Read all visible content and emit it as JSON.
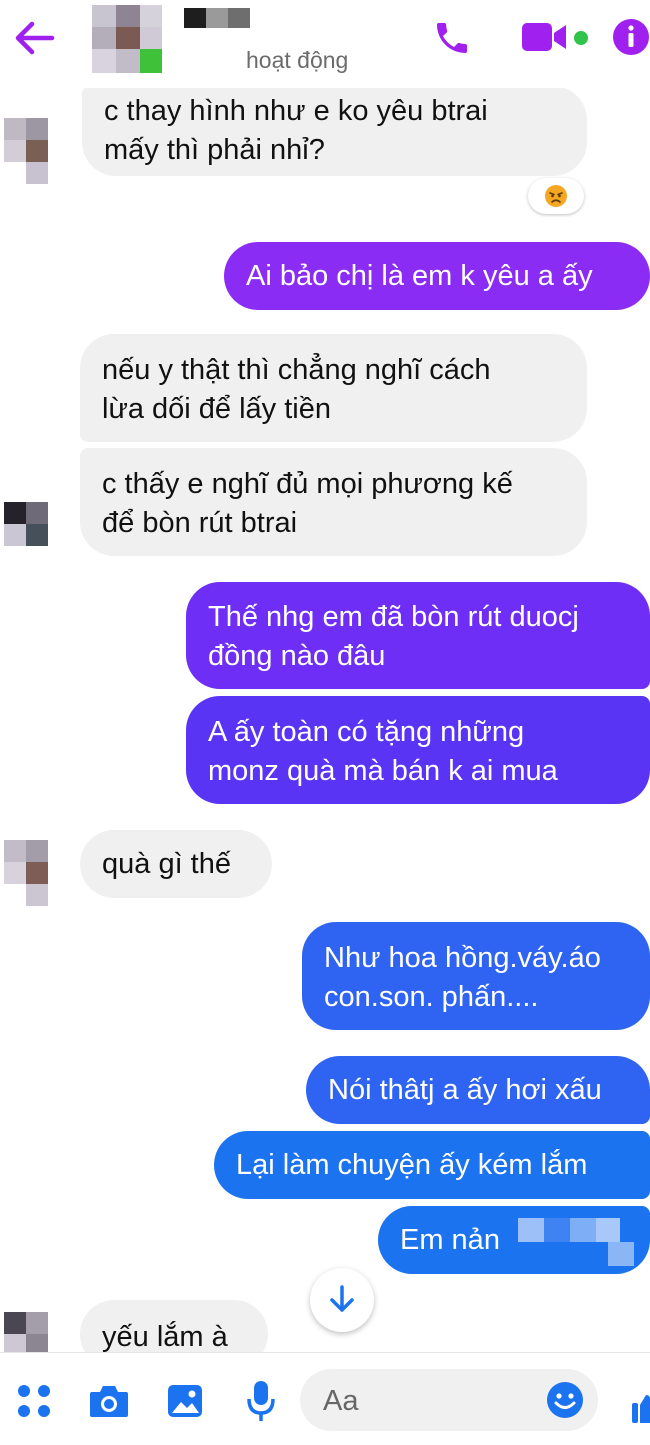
{
  "header": {
    "status_text": "hoạt động",
    "colors": {
      "accent": "#a020f0",
      "online": "#31c44a"
    },
    "icons": [
      "back-arrow-icon",
      "phone-icon",
      "video-camera-icon",
      "info-icon"
    ]
  },
  "messages": [
    {
      "from": "them",
      "lines": [
        "c thay hình như e ko yêu btrai",
        "mấy thì phải nhỉ?"
      ],
      "reaction": "😠"
    },
    {
      "from": "me",
      "lines": [
        "Ai bảo chị là em k yêu a ấy"
      ]
    },
    {
      "from": "them",
      "lines": [
        "nếu y thật thì chẳng nghĩ cách",
        "lừa dối để lấy tiền"
      ]
    },
    {
      "from": "them",
      "lines": [
        "c thấy e nghĩ đủ mọi phương kế",
        "để bòn rút btrai"
      ]
    },
    {
      "from": "me",
      "lines": [
        "Thế nhg em đã bòn rút duocj",
        "đồng nào đâu"
      ]
    },
    {
      "from": "me",
      "lines": [
        "A ấy toàn có tặng những",
        "monz quà mà bán k ai mua"
      ]
    },
    {
      "from": "them",
      "lines": [
        "quà gì thế"
      ]
    },
    {
      "from": "me",
      "lines": [
        "Như hoa hồng.váy.áo",
        "con.son. phấn...."
      ]
    },
    {
      "from": "me",
      "lines": [
        "Nói thâtj a ấy hơi xấu"
      ]
    },
    {
      "from": "me",
      "lines": [
        "Lại làm chuyện ấy kém lắm"
      ]
    },
    {
      "from": "me",
      "lines": [
        "Em nản"
      ]
    },
    {
      "from": "them",
      "lines": [
        "yếu lắm à"
      ]
    }
  ],
  "composer": {
    "placeholder": "Aa",
    "icons": [
      "apps-grid-icon",
      "camera-icon",
      "gallery-icon",
      "microphone-icon",
      "emoji-icon",
      "like-icon"
    ]
  }
}
